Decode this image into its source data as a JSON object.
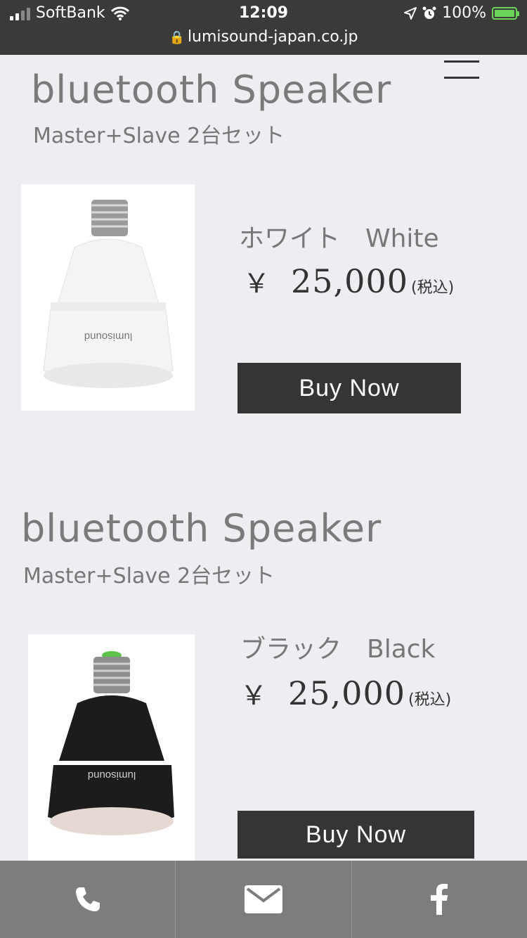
{
  "status_bar": {
    "carrier": "SoftBank",
    "time": "12:09",
    "battery": "100%",
    "url": "lumisound-japan.co.jp"
  },
  "menu_icon": "hamburger-menu-icon",
  "products": [
    {
      "title": "bluetooth Speaker",
      "subtitle": "Master+Slave 2台セット",
      "color_label": "ホワイト　White",
      "yen": "￥",
      "price": "25,000",
      "tax_note": "(税込)",
      "buy_label": "Buy Now",
      "bulb_color": "#f4f4f4",
      "brand_text": "lumisound"
    },
    {
      "title": "bluetooth Speaker",
      "subtitle": "Master+Slave 2台セット",
      "color_label": "ブラック　Black",
      "yen": "￥",
      "price": "25,000",
      "tax_note": "(税込)",
      "buy_label": "Buy Now",
      "bulb_color": "#1c1c1c",
      "brand_text": "lumisound"
    }
  ],
  "bottom_bar": {
    "items": [
      {
        "icon": "phone-icon"
      },
      {
        "icon": "mail-icon"
      },
      {
        "icon": "facebook-icon"
      }
    ]
  },
  "colors": {
    "status_bar_bg": "#3a3a3a",
    "page_bg": "#eeeef2",
    "button_bg": "#353535",
    "bottom_bar_bg": "#7d7d7d",
    "battery_green": "#6bd35a"
  }
}
